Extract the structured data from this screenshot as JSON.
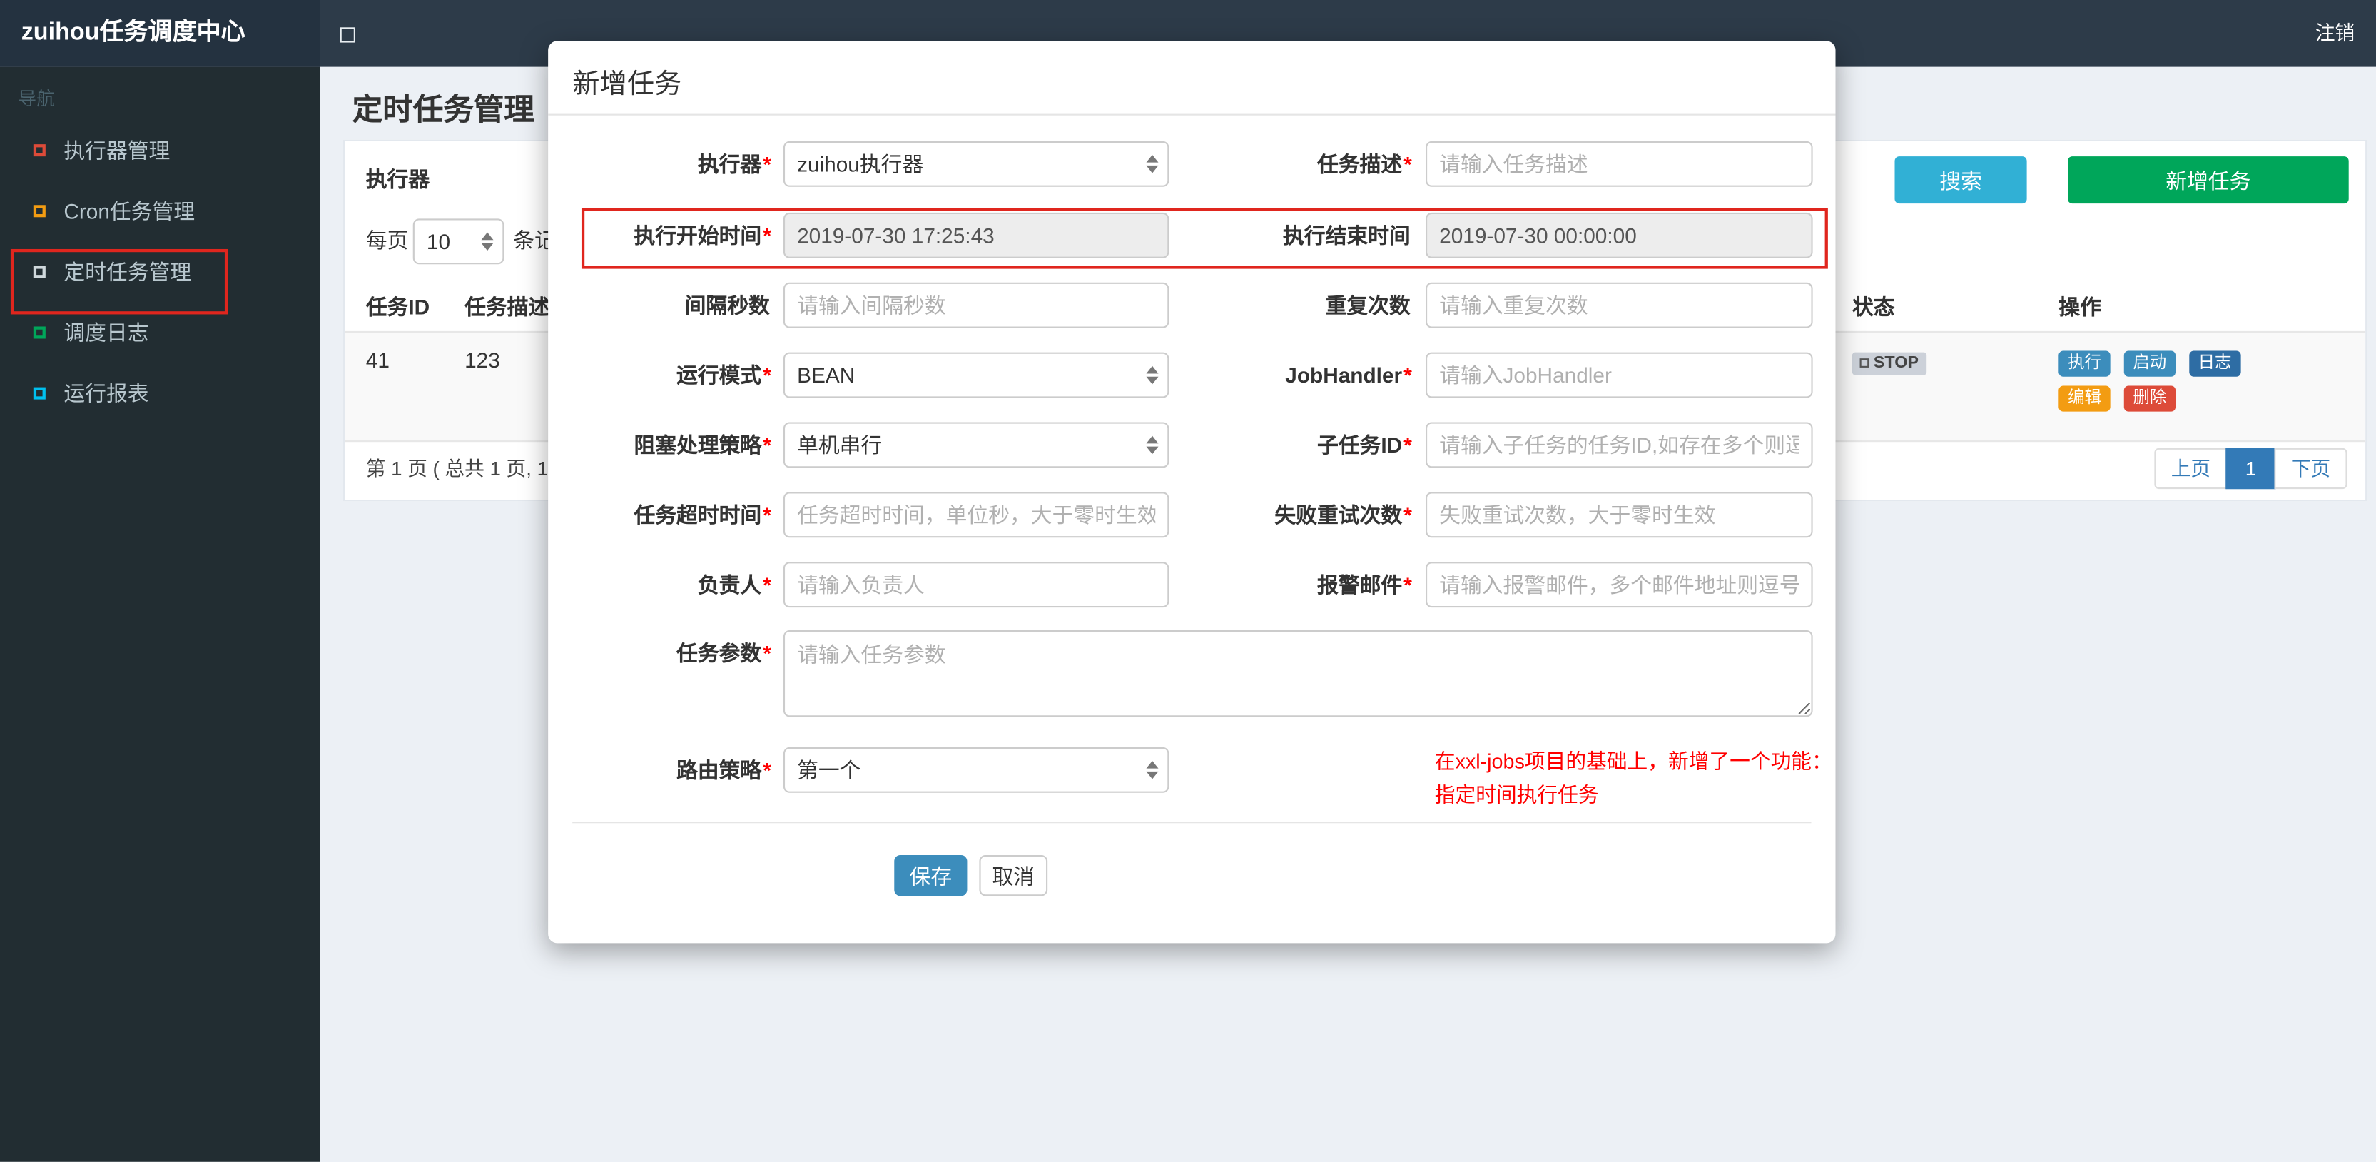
{
  "colors": {
    "navbar_bg": "#2d3b49",
    "logo_bg": "#243240",
    "sidebar_bg": "#222d32",
    "content_bg": "#ecf0f5",
    "search_button_bg": "#31b0d5",
    "add_button_bg": "#00a65a",
    "save_button_bg": "#3c8dbc",
    "active_page_bg": "#337ab7",
    "annotation_red": "#e0261e",
    "note_red": "#ff0000"
  },
  "navbar": {
    "logo": "zuihou任务调度中心",
    "logout": "注销"
  },
  "sidebar": {
    "header": "导航",
    "items": [
      {
        "label": "执行器管理",
        "icon_color": "#dd4b39"
      },
      {
        "label": "Cron任务管理",
        "icon_color": "#f39c12"
      },
      {
        "label": "定时任务管理",
        "icon_color": "#cfd8dc"
      },
      {
        "label": "调度日志",
        "icon_color": "#00a65a"
      },
      {
        "label": "运行报表",
        "icon_color": "#00c0ef"
      }
    ]
  },
  "page": {
    "title": "定时任务管理",
    "filter_label": "执行器",
    "search_button": "搜索",
    "add_button": "新增任务",
    "per_page_prefix": "每页",
    "per_page_value": "10",
    "per_page_suffix": "条记录",
    "table": {
      "headers": {
        "task_id": "任务ID",
        "task_desc": "任务描述",
        "status": "状态",
        "ops": "操作"
      },
      "row": {
        "task_id": "41",
        "task_desc": "123",
        "status": "STOP",
        "ops": [
          {
            "label": "执行",
            "color": "#3c8dbc"
          },
          {
            "label": "启动",
            "color": "#3c8dbc"
          },
          {
            "label": "日志",
            "color": "#2e6da4"
          },
          {
            "label": "编辑",
            "color": "#f39c12"
          },
          {
            "label": "删除",
            "color": "#dd4b39"
          }
        ]
      }
    },
    "pagination": {
      "info": "第 1 页 ( 总共 1 页, 1",
      "prev": "上页",
      "current": "1",
      "next": "下页"
    }
  },
  "modal": {
    "title": "新增任务",
    "fields": {
      "executor": {
        "label": "执行器",
        "req": "*",
        "value": "zuihou执行器"
      },
      "task_desc": {
        "label": "任务描述",
        "req": "*",
        "placeholder": "请输入任务描述"
      },
      "start_time": {
        "label": "执行开始时间",
        "req": "*",
        "value": "2019-07-30 17:25:43"
      },
      "end_time": {
        "label": "执行结束时间",
        "req": "",
        "value": "2019-07-30 00:00:00"
      },
      "interval_seconds": {
        "label": "间隔秒数",
        "req": "",
        "placeholder": "请输入间隔秒数"
      },
      "repeat_count": {
        "label": "重复次数",
        "req": "",
        "placeholder": "请输入重复次数"
      },
      "run_mode": {
        "label": "运行模式",
        "req": "*",
        "value": "BEAN"
      },
      "job_handler": {
        "label": "JobHandler",
        "req": "*",
        "placeholder": "请输入JobHandler"
      },
      "block_strategy": {
        "label": "阻塞处理策略",
        "req": "*",
        "value": "单机串行"
      },
      "child_task_id": {
        "label": "子任务ID",
        "req": "*",
        "placeholder": "请输入子任务的任务ID,如存在多个则逗"
      },
      "timeout": {
        "label": "任务超时时间",
        "req": "*",
        "placeholder": "任务超时时间，单位秒，大于零时生效"
      },
      "fail_retry": {
        "label": "失败重试次数",
        "req": "*",
        "placeholder": "失败重试次数，大于零时生效"
      },
      "owner": {
        "label": "负责人",
        "req": "*",
        "placeholder": "请输入负责人"
      },
      "alarm_email": {
        "label": "报警邮件",
        "req": "*",
        "placeholder": "请输入报警邮件，多个邮件地址则逗号分"
      },
      "task_params": {
        "label": "任务参数",
        "req": "*",
        "placeholder": "请输入任务参数"
      },
      "route_strategy": {
        "label": "路由策略",
        "req": "*",
        "value": "第一个"
      }
    },
    "note_line1": "在xxl-jobs项目的基础上，新增了一个功能：",
    "note_line2": "指定时间执行任务",
    "save_button": "保存",
    "cancel_button": "取消"
  }
}
